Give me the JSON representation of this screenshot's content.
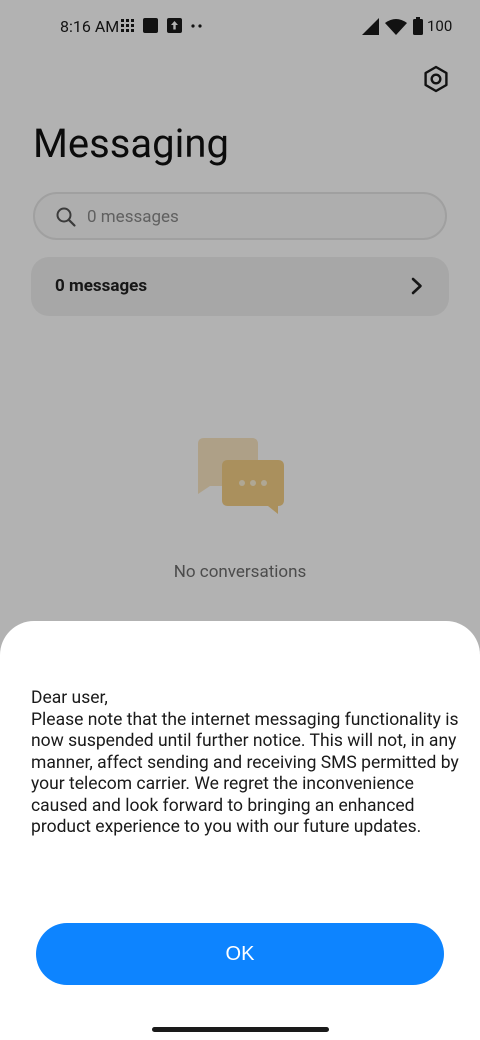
{
  "status_bar": {
    "time": "8:16 AM",
    "battery": "100",
    "left_icons": [
      "grid-icon",
      "square-notification-icon",
      "upload-notification-icon",
      "more-dots-icon"
    ],
    "right_icons": [
      "cell-signal-icon",
      "wifi-icon",
      "battery-icon"
    ]
  },
  "header": {
    "title": "Messaging",
    "settings_icon": "settings-gear-icon"
  },
  "search": {
    "placeholder": "0 messages"
  },
  "category": {
    "label": "0 messages"
  },
  "empty_state": {
    "text": "No conversations",
    "illustration_color": "#f2c46d"
  },
  "dialog": {
    "message": "Dear user,\nPlease note that the internet messaging functionality is now suspended until further notice. This will not, in any manner, affect sending and receiving SMS permitted by your telecom carrier. We regret the inconvenience caused and look forward to bringing an enhanced product experience to you with our future updates.",
    "ok_label": "OK",
    "accent_color": "#0d84ff"
  }
}
